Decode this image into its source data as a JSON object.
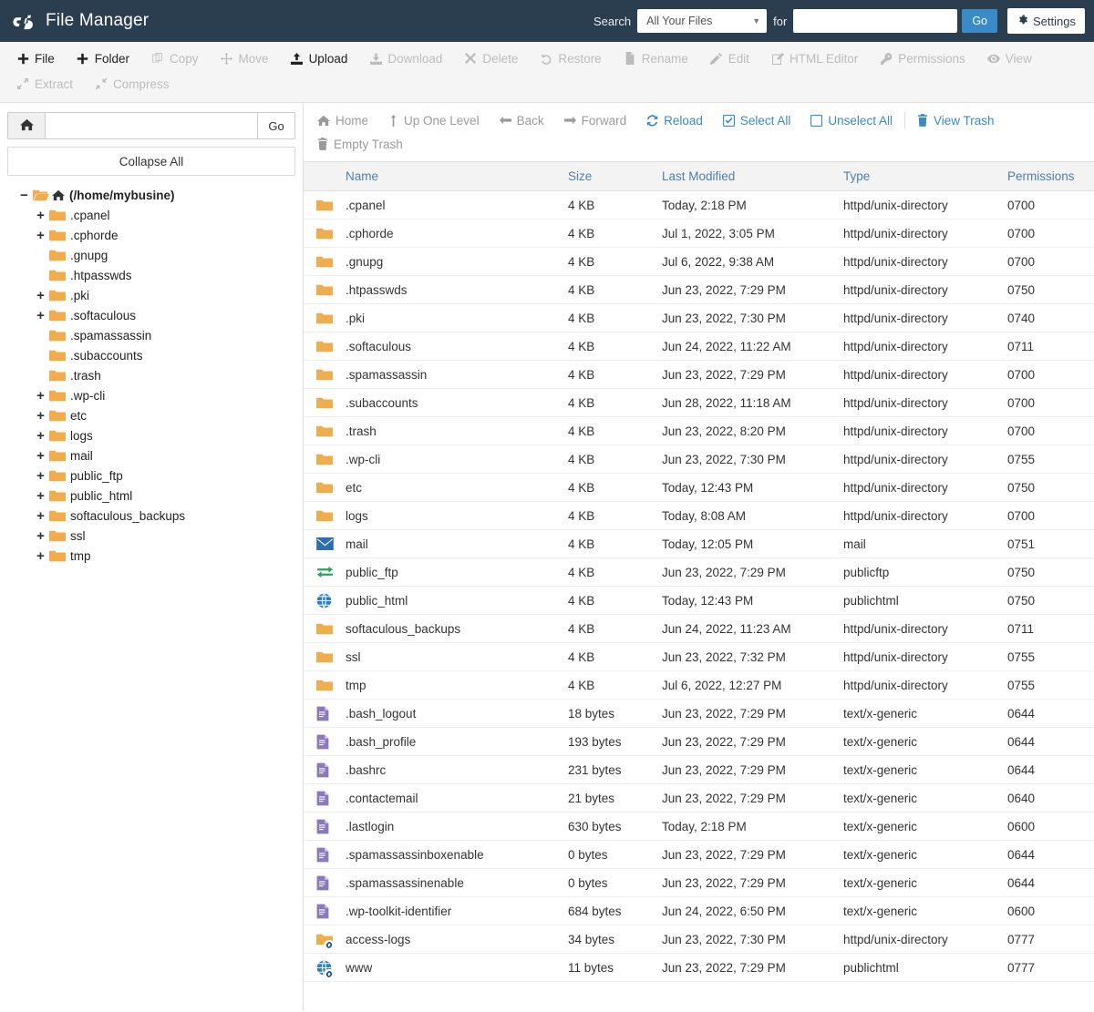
{
  "header": {
    "app_title": "File Manager",
    "logo_icon": "cpanel-logo-icon",
    "search_label": "Search",
    "search_scope": "All Your Files",
    "for_label": "for",
    "search_value": "",
    "search_placeholder": "",
    "go_label": "Go",
    "settings_label": "Settings",
    "settings_icon": "gear-icon",
    "bg_color": "#2b3e50",
    "accent_color": "#3a8ac8"
  },
  "toolbar": {
    "row1": [
      {
        "label": "File",
        "icon": "plus-icon",
        "enabled": true
      },
      {
        "label": "Folder",
        "icon": "plus-icon",
        "enabled": true
      },
      {
        "label": "Copy",
        "icon": "copy-icon",
        "enabled": false
      },
      {
        "label": "Move",
        "icon": "move-icon",
        "enabled": false
      },
      {
        "label": "Upload",
        "icon": "upload-icon",
        "enabled": true
      },
      {
        "label": "Download",
        "icon": "download-icon",
        "enabled": false
      },
      {
        "label": "Delete",
        "icon": "times-icon",
        "enabled": false
      },
      {
        "label": "Restore",
        "icon": "undo-icon",
        "enabled": false
      },
      {
        "label": "Rename",
        "icon": "file-icon",
        "enabled": false
      },
      {
        "label": "Edit",
        "icon": "pencil-icon",
        "enabled": false
      },
      {
        "label": "HTML Editor",
        "icon": "html-editor-icon",
        "enabled": false
      },
      {
        "label": "Permissions",
        "icon": "key-icon",
        "enabled": false
      },
      {
        "label": "View",
        "icon": "eye-icon",
        "enabled": false
      }
    ],
    "row2": [
      {
        "label": "Extract",
        "icon": "expand-icon",
        "enabled": false
      },
      {
        "label": "Compress",
        "icon": "compress-icon",
        "enabled": false
      }
    ]
  },
  "sidebar": {
    "home_icon": "home-icon",
    "path_value": "",
    "path_placeholder": "",
    "go_label": "Go",
    "collapse_all_label": "Collapse All",
    "tree": [
      {
        "label": "(/home/mybusine)",
        "toggle": "minus",
        "icon": "folder-open-home-icon",
        "root": true
      },
      {
        "label": ".cpanel",
        "toggle": "plus",
        "icon": "folder-icon",
        "root": false
      },
      {
        "label": ".cphorde",
        "toggle": "plus",
        "icon": "folder-icon",
        "root": false
      },
      {
        "label": ".gnupg",
        "toggle": "none",
        "icon": "folder-icon",
        "root": false
      },
      {
        "label": ".htpasswds",
        "toggle": "none",
        "icon": "folder-icon",
        "root": false
      },
      {
        "label": ".pki",
        "toggle": "plus",
        "icon": "folder-icon",
        "root": false
      },
      {
        "label": ".softaculous",
        "toggle": "plus",
        "icon": "folder-icon",
        "root": false
      },
      {
        "label": ".spamassassin",
        "toggle": "none",
        "icon": "folder-icon",
        "root": false
      },
      {
        "label": ".subaccounts",
        "toggle": "none",
        "icon": "folder-icon",
        "root": false
      },
      {
        "label": ".trash",
        "toggle": "none",
        "icon": "folder-icon",
        "root": false
      },
      {
        "label": ".wp-cli",
        "toggle": "plus",
        "icon": "folder-icon",
        "root": false
      },
      {
        "label": "etc",
        "toggle": "plus",
        "icon": "folder-icon",
        "root": false
      },
      {
        "label": "logs",
        "toggle": "plus",
        "icon": "folder-icon",
        "root": false
      },
      {
        "label": "mail",
        "toggle": "plus",
        "icon": "folder-icon",
        "root": false
      },
      {
        "label": "public_ftp",
        "toggle": "plus",
        "icon": "folder-icon",
        "root": false
      },
      {
        "label": "public_html",
        "toggle": "plus",
        "icon": "folder-icon",
        "root": false
      },
      {
        "label": "softaculous_backups",
        "toggle": "plus",
        "icon": "folder-icon",
        "root": false
      },
      {
        "label": "ssl",
        "toggle": "plus",
        "icon": "folder-icon",
        "root": false
      },
      {
        "label": "tmp",
        "toggle": "plus",
        "icon": "folder-icon",
        "root": false
      }
    ]
  },
  "navbar": {
    "items": [
      {
        "label": "Home",
        "icon": "home-icon",
        "style": "gray"
      },
      {
        "label": "Up One Level",
        "icon": "arrow-up-icon",
        "style": "gray"
      },
      {
        "label": "Back",
        "icon": "arrow-left-icon",
        "style": "gray"
      },
      {
        "label": "Forward",
        "icon": "arrow-right-icon",
        "style": "gray"
      },
      {
        "label": "Reload",
        "icon": "refresh-icon",
        "style": "blue"
      },
      {
        "label": "Select All",
        "icon": "checkbox-checked-icon",
        "style": "blue"
      },
      {
        "label": "Unselect All",
        "icon": "checkbox-empty-icon",
        "style": "blue"
      },
      {
        "label": "View Trash",
        "icon": "trash-icon",
        "style": "blue",
        "sep_before": true
      }
    ],
    "items_row2": [
      {
        "label": "Empty Trash",
        "icon": "trash-icon",
        "style": "gray"
      }
    ]
  },
  "table": {
    "columns": [
      "Name",
      "Size",
      "Last Modified",
      "Type",
      "Permissions"
    ],
    "rows": [
      {
        "name": ".cpanel",
        "size": "4 KB",
        "modified": "Today, 2:18 PM",
        "type": "httpd/unix-directory",
        "perms": "0700",
        "icon": "folder-icon"
      },
      {
        "name": ".cphorde",
        "size": "4 KB",
        "modified": "Jul 1, 2022, 3:05 PM",
        "type": "httpd/unix-directory",
        "perms": "0700",
        "icon": "folder-icon"
      },
      {
        "name": ".gnupg",
        "size": "4 KB",
        "modified": "Jul 6, 2022, 9:38 AM",
        "type": "httpd/unix-directory",
        "perms": "0700",
        "icon": "folder-icon"
      },
      {
        "name": ".htpasswds",
        "size": "4 KB",
        "modified": "Jun 23, 2022, 7:29 PM",
        "type": "httpd/unix-directory",
        "perms": "0750",
        "icon": "folder-icon"
      },
      {
        "name": ".pki",
        "size": "4 KB",
        "modified": "Jun 23, 2022, 7:30 PM",
        "type": "httpd/unix-directory",
        "perms": "0740",
        "icon": "folder-icon"
      },
      {
        "name": ".softaculous",
        "size": "4 KB",
        "modified": "Jun 24, 2022, 11:22 AM",
        "type": "httpd/unix-directory",
        "perms": "0711",
        "icon": "folder-icon"
      },
      {
        "name": ".spamassassin",
        "size": "4 KB",
        "modified": "Jun 23, 2022, 7:29 PM",
        "type": "httpd/unix-directory",
        "perms": "0700",
        "icon": "folder-icon"
      },
      {
        "name": ".subaccounts",
        "size": "4 KB",
        "modified": "Jun 28, 2022, 11:18 AM",
        "type": "httpd/unix-directory",
        "perms": "0700",
        "icon": "folder-icon"
      },
      {
        "name": ".trash",
        "size": "4 KB",
        "modified": "Jun 23, 2022, 8:20 PM",
        "type": "httpd/unix-directory",
        "perms": "0700",
        "icon": "folder-icon"
      },
      {
        "name": ".wp-cli",
        "size": "4 KB",
        "modified": "Jun 23, 2022, 7:30 PM",
        "type": "httpd/unix-directory",
        "perms": "0755",
        "icon": "folder-icon"
      },
      {
        "name": "etc",
        "size": "4 KB",
        "modified": "Today, 12:43 PM",
        "type": "httpd/unix-directory",
        "perms": "0750",
        "icon": "folder-icon"
      },
      {
        "name": "logs",
        "size": "4 KB",
        "modified": "Today, 8:08 AM",
        "type": "httpd/unix-directory",
        "perms": "0700",
        "icon": "folder-icon"
      },
      {
        "name": "mail",
        "size": "4 KB",
        "modified": "Today, 12:05 PM",
        "type": "mail",
        "perms": "0751",
        "icon": "mail-icon"
      },
      {
        "name": "public_ftp",
        "size": "4 KB",
        "modified": "Jun 23, 2022, 7:29 PM",
        "type": "publicftp",
        "perms": "0750",
        "icon": "ftp-exchange-icon"
      },
      {
        "name": "public_html",
        "size": "4 KB",
        "modified": "Today, 12:43 PM",
        "type": "publichtml",
        "perms": "0750",
        "icon": "globe-icon"
      },
      {
        "name": "softaculous_backups",
        "size": "4 KB",
        "modified": "Jun 24, 2022, 11:23 AM",
        "type": "httpd/unix-directory",
        "perms": "0711",
        "icon": "folder-icon"
      },
      {
        "name": "ssl",
        "size": "4 KB",
        "modified": "Jun 23, 2022, 7:32 PM",
        "type": "httpd/unix-directory",
        "perms": "0755",
        "icon": "folder-icon"
      },
      {
        "name": "tmp",
        "size": "4 KB",
        "modified": "Jul 6, 2022, 12:27 PM",
        "type": "httpd/unix-directory",
        "perms": "0755",
        "icon": "folder-icon"
      },
      {
        "name": ".bash_logout",
        "size": "18 bytes",
        "modified": "Jun 23, 2022, 7:29 PM",
        "type": "text/x-generic",
        "perms": "0644",
        "icon": "text-file-icon"
      },
      {
        "name": ".bash_profile",
        "size": "193 bytes",
        "modified": "Jun 23, 2022, 7:29 PM",
        "type": "text/x-generic",
        "perms": "0644",
        "icon": "text-file-icon"
      },
      {
        "name": ".bashrc",
        "size": "231 bytes",
        "modified": "Jun 23, 2022, 7:29 PM",
        "type": "text/x-generic",
        "perms": "0644",
        "icon": "text-file-icon"
      },
      {
        "name": ".contactemail",
        "size": "21 bytes",
        "modified": "Jun 23, 2022, 7:29 PM",
        "type": "text/x-generic",
        "perms": "0640",
        "icon": "text-file-icon"
      },
      {
        "name": ".lastlogin",
        "size": "630 bytes",
        "modified": "Today, 2:18 PM",
        "type": "text/x-generic",
        "perms": "0600",
        "icon": "text-file-icon"
      },
      {
        "name": ".spamassassinboxenable",
        "size": "0 bytes",
        "modified": "Jun 23, 2022, 7:29 PM",
        "type": "text/x-generic",
        "perms": "0644",
        "icon": "text-file-icon"
      },
      {
        "name": ".spamassassinenable",
        "size": "0 bytes",
        "modified": "Jun 23, 2022, 7:29 PM",
        "type": "text/x-generic",
        "perms": "0644",
        "icon": "text-file-icon"
      },
      {
        "name": ".wp-toolkit-identifier",
        "size": "684 bytes",
        "modified": "Jun 24, 2022, 6:50 PM",
        "type": "text/x-generic",
        "perms": "0600",
        "icon": "text-file-icon"
      },
      {
        "name": "access-logs",
        "size": "34 bytes",
        "modified": "Jun 23, 2022, 7:30 PM",
        "type": "httpd/unix-directory",
        "perms": "0777",
        "icon": "folder-icon",
        "symlink": true
      },
      {
        "name": "www",
        "size": "11 bytes",
        "modified": "Jun 23, 2022, 7:29 PM",
        "type": "publichtml",
        "perms": "0777",
        "icon": "globe-icon",
        "symlink": true
      }
    ]
  }
}
